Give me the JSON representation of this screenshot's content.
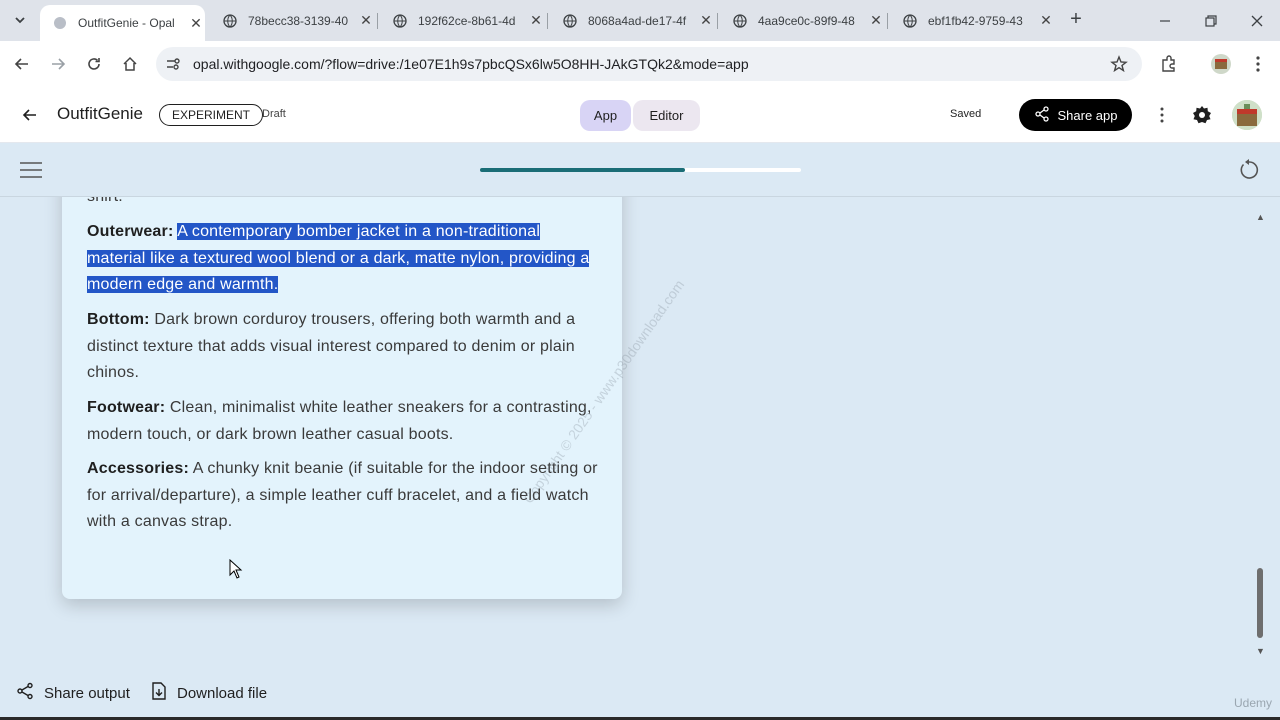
{
  "browser": {
    "tabs": [
      {
        "title": "OutfitGenie - Opal",
        "active": true
      },
      {
        "title": "78becc38-3139-40",
        "active": false
      },
      {
        "title": "192f62ce-8b61-4d",
        "active": false
      },
      {
        "title": "8068a4ad-de17-4f",
        "active": false
      },
      {
        "title": "4aa9ce0c-89f9-48",
        "active": false
      },
      {
        "title": "ebf1fb42-9759-43",
        "active": false
      }
    ],
    "url": "opal.withgoogle.com/?flow=drive:/1e07E1h9s7pbcQSx6lw5O8HH-JAkGTQk2&mode=app"
  },
  "app": {
    "name": "OutfitGenie",
    "badge": "EXPERIMENT",
    "status": "Draft",
    "mode_app": "App",
    "mode_editor": "Editor",
    "saved": "Saved",
    "share_label": "Share app",
    "progress_fraction": 0.64
  },
  "output": {
    "partial_top": "fabric. This offers a more relaxed collar option than the band-collar shirt.",
    "outerwear_label": "Outerwear:",
    "outerwear_text": "A contemporary bomber jacket in a non-traditional material like a textured wool blend or a dark, matte nylon, providing a modern edge and warmth.",
    "bottom_label": "Bottom:",
    "bottom_text": "Dark brown corduroy trousers, offering both warmth and a distinct texture that adds visual interest compared to denim or plain chinos.",
    "footwear_label": "Footwear:",
    "footwear_text": "Clean, minimalist white leather sneakers for a contrasting, modern touch, or dark brown leather casual boots.",
    "accessories_label": "Accessories:",
    "accessories_text": "A chunky knit beanie (if suitable for the indoor setting or for arrival/departure), a simple leather cuff bracelet, and a field watch with a canvas strap."
  },
  "watermark": "Copyright © 2025 - www.p30download.com",
  "footer": {
    "share_output": "Share output",
    "download_file": "Download file",
    "udemy": "Udemy"
  },
  "colors": {
    "page_bg": "#dbe9f4",
    "card_bg": "#e3f3fc",
    "selection": "#2356c7",
    "progress": "#1a6d76",
    "app_mode_bg": "#d8d4f5"
  }
}
